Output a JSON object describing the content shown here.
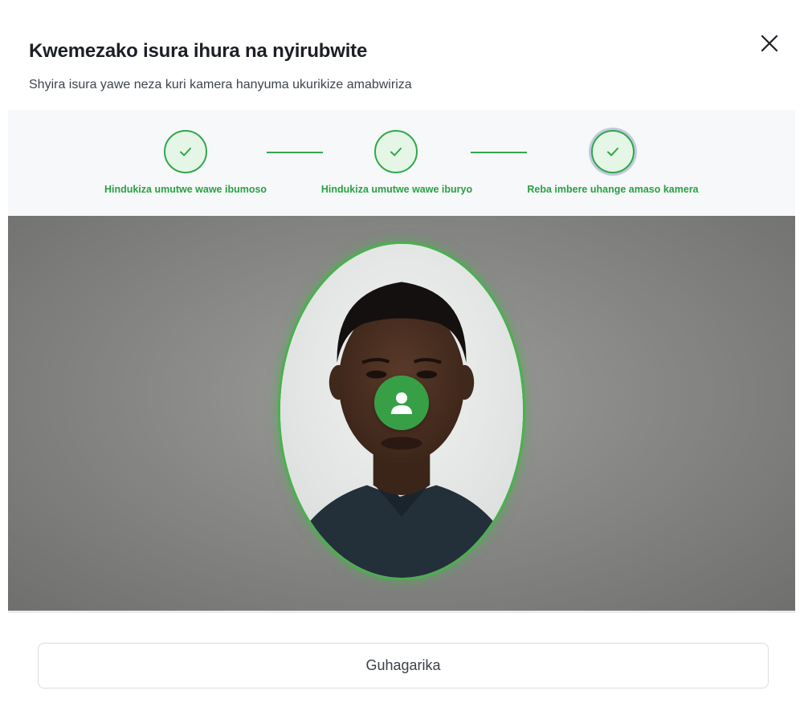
{
  "dialog": {
    "title": "Kwemezako isura ihura na nyirubwite",
    "subtitle": "Shyira isura yawe neza kuri kamera hanyuma ukurikize amabwiriza",
    "close_icon": "close-icon"
  },
  "steps": [
    {
      "label": "Hindukiza umutwe wawe ibumoso",
      "status": "complete",
      "icon": "check-icon"
    },
    {
      "label": "Hindukiza umutwe wawe iburyo",
      "status": "complete",
      "icon": "check-icon"
    },
    {
      "label": "Reba imbere uhange amaso kamera",
      "status": "complete-active",
      "icon": "check-icon"
    }
  ],
  "camera": {
    "overlay_icon": "user-icon",
    "accent_color": "#37a046"
  },
  "footer": {
    "cancel_label": "Guhagarika"
  },
  "colors": {
    "success": "#31a84a",
    "step_bg": "#e5f6e6",
    "text_dark": "#1c1f25"
  }
}
